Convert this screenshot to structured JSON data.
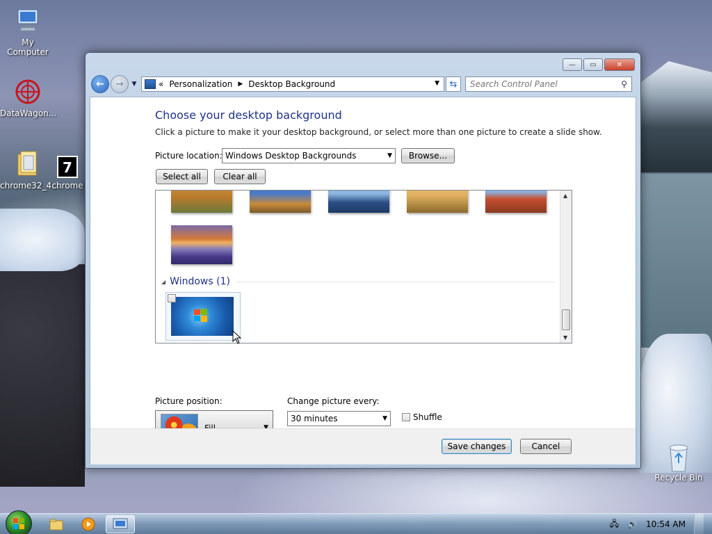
{
  "desktop": {
    "icons": [
      {
        "label": "My Computer"
      },
      {
        "label": "DataWagon..."
      },
      {
        "label": "chrome32_4..."
      },
      {
        "label": "chrome"
      },
      {
        "label": "Recycle Bin"
      }
    ]
  },
  "window": {
    "controls": {
      "minimize": "—",
      "maximize": "▭",
      "close": "✕"
    },
    "breadcrumb": {
      "overflow": "«",
      "items": [
        "Personalization",
        "Desktop Background"
      ]
    },
    "search": {
      "placeholder": "Search Control Panel"
    },
    "heading": "Choose your desktop background",
    "subtext": "Click a picture to make it your desktop background, or select more than one picture to create a slide show.",
    "picture_location": {
      "label": "Picture location:",
      "value": "Windows Desktop Backgrounds",
      "browse_label": "Browse..."
    },
    "select_all_label": "Select all",
    "clear_all_label": "Clear all",
    "gallery": {
      "group_title": "Windows (1)",
      "thumb_colors": [
        [
          "#c9893a",
          "#5b6b2a"
        ],
        [
          "#3f6fbf",
          "#c98a3a"
        ],
        [
          "#6d9ed6",
          "#2b4f86"
        ],
        [
          "#e0b060",
          "#8a6a2a"
        ],
        [
          "#5f8fd0",
          "#c65030"
        ],
        [
          "#d27a3a",
          "#5a4a9a"
        ]
      ]
    },
    "picture_position": {
      "label": "Picture position:",
      "value": "Fill"
    },
    "change_picture": {
      "label": "Change picture every:",
      "value": "30 minutes"
    },
    "shuffle_label": "Shuffle",
    "save_label": "Save changes",
    "cancel_label": "Cancel"
  },
  "taskbar": {
    "clock": "10:54 AM"
  }
}
